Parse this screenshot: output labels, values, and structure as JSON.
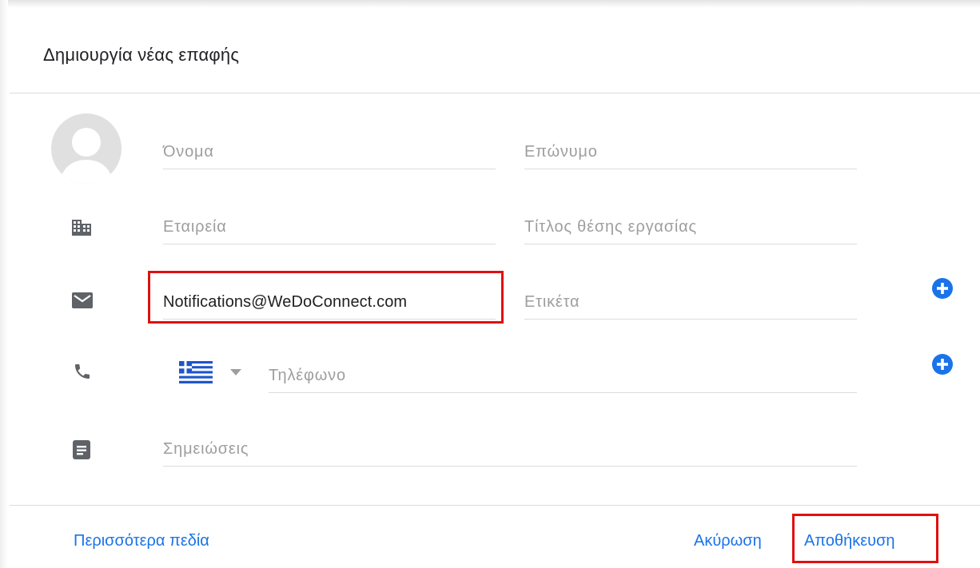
{
  "dialog": {
    "title": "Δημιουργία νέας επαφής"
  },
  "fields": {
    "first_name": {
      "placeholder": "Όνομα",
      "value": ""
    },
    "last_name": {
      "placeholder": "Επώνυμο",
      "value": ""
    },
    "company": {
      "placeholder": "Εταιρεία",
      "value": ""
    },
    "job_title": {
      "placeholder": "Τίτλος θέσης εργασίας",
      "value": ""
    },
    "email": {
      "placeholder": "",
      "value": "Notifications@WeDoConnect.com"
    },
    "email_label": {
      "placeholder": "Ετικέτα",
      "value": ""
    },
    "phone_country": "greece-flag-icon",
    "phone": {
      "placeholder": "Τηλέφωνο",
      "value": ""
    },
    "notes": {
      "placeholder": "Σημειώσεις",
      "value": ""
    }
  },
  "footer": {
    "more_fields": "Περισσότερα πεδία",
    "cancel": "Ακύρωση",
    "save": "Αποθήκευση"
  },
  "icons": {
    "company": "building-icon",
    "email": "envelope-icon",
    "phone": "phone-icon",
    "notes": "notes-icon",
    "add": "plus-circle-icon",
    "dropdown": "triangle-down-icon"
  },
  "colors": {
    "accent": "#1a73e8",
    "highlight": "#e01010",
    "icon": "#5f6368",
    "placeholder": "#9e9e9e",
    "divider": "#dadce0"
  }
}
